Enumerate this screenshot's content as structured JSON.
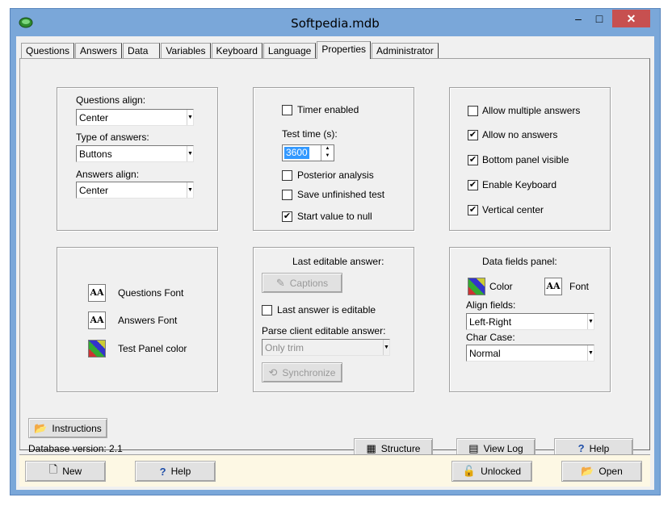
{
  "window": {
    "title": "Softpedia.mdb",
    "min": "‒",
    "max": "□",
    "close": "✕"
  },
  "tabs": [
    "Questions",
    "Answers",
    "Data",
    "Variables",
    "Keyboard",
    "Language",
    "Properties",
    "Administrator"
  ],
  "active_tab": "Properties",
  "alignment": {
    "questions_align_label": "Questions align:",
    "questions_align_value": "Center",
    "answer_type_label": "Type of answers:",
    "answer_type_value": "Buttons",
    "answers_align_label": "Answers align:",
    "answers_align_value": "Center"
  },
  "timer": {
    "timer_enabled": "Timer enabled",
    "test_time_label": "Test time (s):",
    "test_time_value": "3600",
    "posterior_analysis": "Posterior analysis",
    "save_unfinished": "Save unfinished test",
    "start_value_null": "Start value to null"
  },
  "options": {
    "allow_multiple": "Allow multiple answers",
    "allow_no": "Allow no answers",
    "bottom_panel": "Bottom panel visible",
    "enable_keyboard": "Enable Keyboard",
    "vertical_center": "Vertical center"
  },
  "fonts": {
    "questions_font": "Questions Font",
    "answers_font": "Answers Font",
    "test_panel_color": "Test Panel color"
  },
  "editable": {
    "header": "Last editable answer:",
    "captions": "Captions",
    "last_answer_editable": "Last answer is editable",
    "parse_label": "Parse client editable answer:",
    "parse_value": "Only trim",
    "synchronize": "Synchronize"
  },
  "datafields": {
    "header": "Data fields panel:",
    "color": "Color",
    "font": "Font",
    "align_label": "Align fields:",
    "align_value": "Left-Right",
    "charcase_label": "Char Case:",
    "charcase_value": "Normal"
  },
  "status": {
    "instructions": "Instructions",
    "db_version": "Database version: 2.1",
    "structure": "Structure",
    "view_log": "View Log",
    "help": "Help"
  },
  "bottom": {
    "new": "New",
    "help": "Help",
    "unlocked": "Unlocked",
    "open": "Open"
  },
  "colors": {
    "titlebar": "#7aa7d9",
    "close": "#c75050",
    "face": "#f0f0f0",
    "strip": "#fdf8e4"
  }
}
